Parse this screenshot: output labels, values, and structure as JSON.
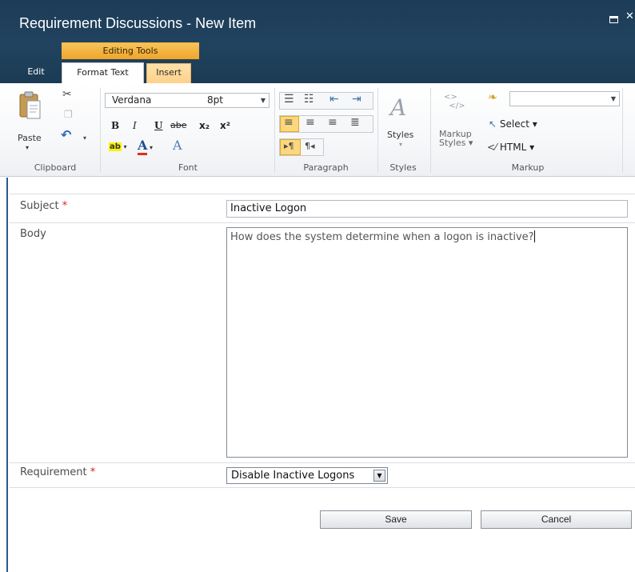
{
  "dialog": {
    "title": "Requirement Discussions - New Item",
    "maximize_glyph": "",
    "close_glyph": "✕"
  },
  "ribbon": {
    "contextual_group": "Editing Tools",
    "tabs": [
      {
        "label": "Edit",
        "active": false
      },
      {
        "label": "Format Text",
        "active": true
      },
      {
        "label": "Insert",
        "active": false
      }
    ],
    "groups": {
      "clipboard": {
        "label": "Clipboard",
        "paste_label": "Paste"
      },
      "font": {
        "label": "Font",
        "font_name": "Verdana",
        "font_size": "8pt",
        "bold": "B",
        "italic": "I",
        "underline": "U",
        "strike": "abe",
        "subscript": "x₂",
        "superscript": "x²",
        "highlight": "ab",
        "font_color": "A",
        "clear_format": "A"
      },
      "paragraph": {
        "label": "Paragraph"
      },
      "styles": {
        "label": "Styles",
        "styles_label": "Styles"
      },
      "markup": {
        "label": "Markup",
        "markup_styles_line1": "Markup",
        "markup_styles_line2": "Styles ▾",
        "select_label": "Select ▾",
        "html_label": "HTML ▾"
      }
    }
  },
  "form": {
    "subject": {
      "label": "Subject",
      "required_mark": "*",
      "value": "Inactive Logon"
    },
    "body": {
      "label": "Body",
      "value": "How does the system determine when a logon is inactive?"
    },
    "requirement": {
      "label": "Requirement",
      "required_mark": "*",
      "selected": "Disable Inactive Logons"
    },
    "save_label": "Save",
    "cancel_label": "Cancel"
  },
  "colors": {
    "header_bg": "#1f3f5b",
    "context_tab": "#f5b445",
    "active_align": "#fbd77d",
    "required": "#e31b1b"
  }
}
